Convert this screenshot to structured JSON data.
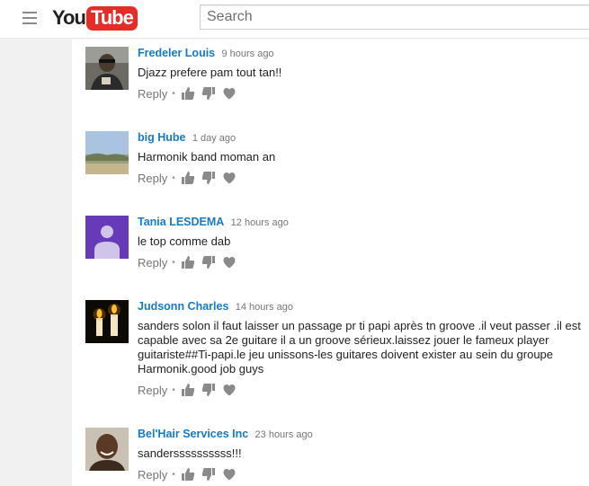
{
  "header": {
    "logo_you": "You",
    "logo_tube": "Tube",
    "search_placeholder": "Search"
  },
  "colors": {
    "brand_red": "#e52d27",
    "author_blue": "#167ac6",
    "muted_gray": "#767676"
  },
  "comments": [
    {
      "author": "Fredeler Louis",
      "time": "9 hours ago",
      "text": "Djazz prefere pam tout tan!!",
      "reply": "Reply"
    },
    {
      "author": "big Hube",
      "time": "1 day ago",
      "text": "Harmonik band moman an",
      "reply": "Reply"
    },
    {
      "author": "Tania LESDEMA",
      "time": "12 hours ago",
      "text": "le top comme dab",
      "reply": "Reply"
    },
    {
      "author": "Judsonn Charles",
      "time": "14 hours ago",
      "text": "sanders solon il faut laisser un passage pr ti papi après tn groove .il veut passer .il est capable avec sa 2e guitare il a un groove sérieux.laissez jouer le fameux player guitariste##Ti-papi.le jeu unissons-les guitares doivent exister au sein du groupe Harmonik.good job guys",
      "reply": "Reply"
    },
    {
      "author": "Bel'Hair Services Inc",
      "time": "23 hours ago",
      "text": "sanderssssssssss!!!",
      "reply": "Reply"
    }
  ],
  "icons": {
    "menu": "hamburger-menu-icon",
    "like": "thumbs-up-icon",
    "dislike": "thumbs-down-icon",
    "heart": "heart-icon"
  }
}
